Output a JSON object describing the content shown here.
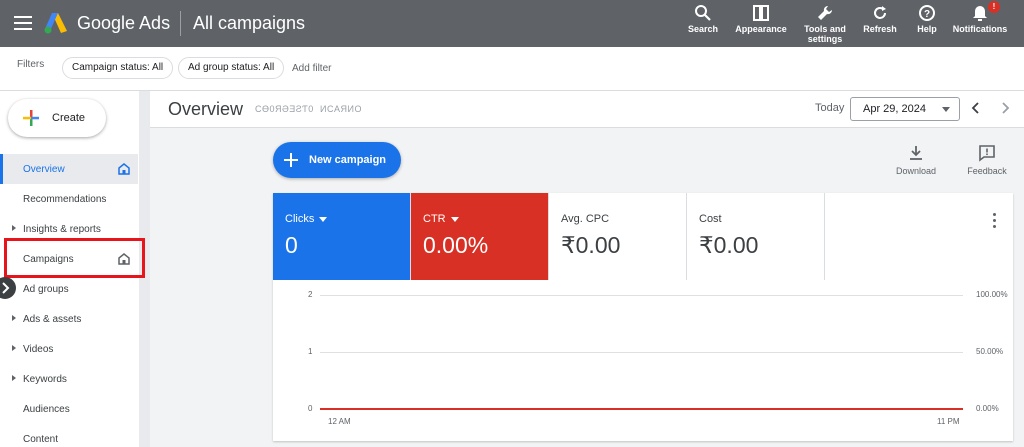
{
  "header": {
    "brand": "Google Ads",
    "page_title": "All campaigns",
    "tools": [
      {
        "label": "Search",
        "icon": "search-icon"
      },
      {
        "label": "Appearance",
        "icon": "appearance-icon"
      },
      {
        "label": "Tools and settings",
        "icon": "wrench-icon"
      },
      {
        "label": "Refresh",
        "icon": "refresh-icon"
      },
      {
        "label": "Help",
        "icon": "help-icon"
      },
      {
        "label": "Notifications",
        "icon": "bell-icon",
        "badge": "!"
      }
    ]
  },
  "filters": {
    "label": "Filters",
    "chips": [
      "Campaign status: All",
      "Ad group status: All"
    ],
    "add_filter": "Add filter"
  },
  "sidebar": {
    "create_label": "Create",
    "items": [
      {
        "label": "Overview",
        "active": true,
        "home": true,
        "caret": false
      },
      {
        "label": "Recommendations",
        "active": false,
        "home": false,
        "caret": false
      },
      {
        "label": "Insights & reports",
        "active": false,
        "home": false,
        "caret": true
      },
      {
        "label": "Campaigns",
        "active": false,
        "home": true,
        "caret": false,
        "highlighted": true
      },
      {
        "label": "Ad groups",
        "active": false,
        "home": false,
        "caret": false
      },
      {
        "label": "Ads & assets",
        "active": false,
        "home": false,
        "caret": true
      },
      {
        "label": "Videos",
        "active": false,
        "home": false,
        "caret": true
      },
      {
        "label": "Keywords",
        "active": false,
        "home": false,
        "caret": true
      },
      {
        "label": "Audiences",
        "active": false,
        "home": false,
        "caret": false
      },
      {
        "label": "Content",
        "active": false,
        "home": false,
        "caret": false
      }
    ]
  },
  "overview": {
    "title": "Overview",
    "sub_a": "CӨ0ЯƏƎƧƬ0",
    "sub_b": "ИCАЯИO",
    "today_label": "Today",
    "date": "Apr 29, 2024"
  },
  "actions": {
    "new_campaign": "New campaign",
    "download": "Download",
    "feedback": "Feedback"
  },
  "metrics": [
    {
      "label": "Clicks",
      "value": "0",
      "style": "blue",
      "dropdown": true
    },
    {
      "label": "CTR",
      "value": "0.00%",
      "style": "red",
      "dropdown": true
    },
    {
      "label": "Avg. CPC",
      "value": "₹0.00",
      "style": "plain",
      "dropdown": false
    },
    {
      "label": "Cost",
      "value": "₹0.00",
      "style": "plain",
      "dropdown": false
    }
  ],
  "colors": {
    "blue": "#1a73e8",
    "red": "#d93025",
    "topbar": "#5f6368"
  },
  "chart_data": {
    "type": "line",
    "x": [
      "12 AM",
      "11 PM"
    ],
    "series": [
      {
        "name": "Clicks",
        "values": [
          0,
          0
        ]
      },
      {
        "name": "CTR",
        "values": [
          0,
          0
        ]
      }
    ],
    "y_left_ticks": [
      "2",
      "1",
      "0"
    ],
    "y_right_ticks": [
      "100.00%",
      "50.00%",
      "0.00%"
    ],
    "ylim": [
      0,
      2
    ],
    "grid": true
  }
}
